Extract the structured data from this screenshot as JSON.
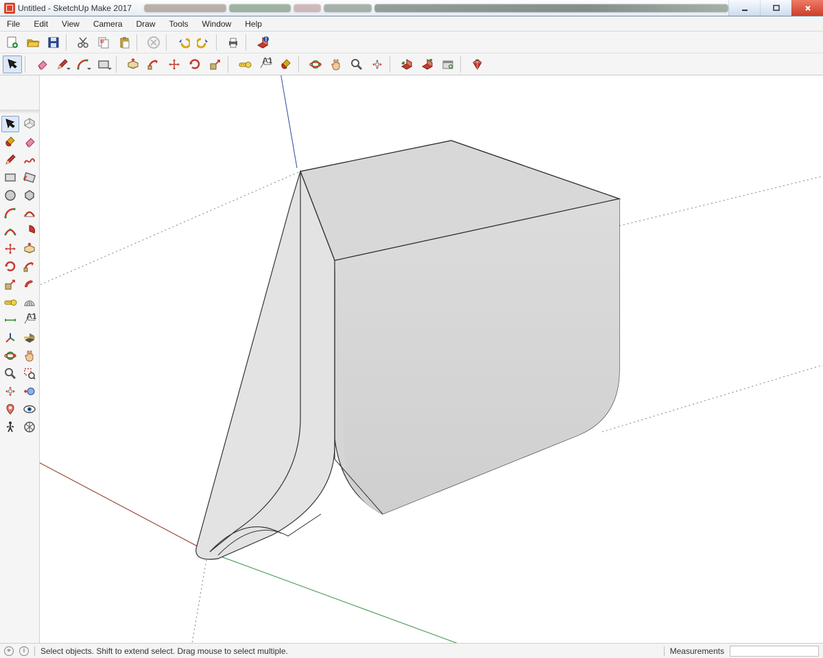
{
  "window": {
    "title": "Untitled - SketchUp Make 2017"
  },
  "menu": {
    "items": [
      "File",
      "Edit",
      "View",
      "Camera",
      "Draw",
      "Tools",
      "Window",
      "Help"
    ]
  },
  "status": {
    "hint": "Select objects. Shift to extend select. Drag mouse to select multiple.",
    "measurements_label": "Measurements",
    "measurements_value": ""
  },
  "toolbar_row1": [
    "new-file",
    "open-file",
    "save-file",
    "sep",
    "cut",
    "copy",
    "paste",
    "sep",
    "delete",
    "sep",
    "undo",
    "redo",
    "sep",
    "print",
    "sep",
    "model-info"
  ],
  "toolbar_row2": [
    "select",
    "sep",
    "eraser",
    "pencil",
    "arc",
    "rectangle",
    "sep",
    "push-pull",
    "follow-me",
    "move",
    "rotate",
    "scale",
    "sep",
    "tape-measure",
    "text-label",
    "paint-bucket",
    "sep",
    "orbit",
    "pan",
    "zoom",
    "zoom-extents",
    "sep",
    "get-models",
    "share-model",
    "extensions",
    "sep",
    "ruby"
  ],
  "left_toolbar": [
    "select",
    "make-component",
    "paint-bucket",
    "eraser",
    "pencil",
    "freehand",
    "rectangle",
    "rotated-rectangle",
    "circle",
    "polygon",
    "arc",
    "two-point-arc",
    "three-point-arc",
    "pie",
    "move",
    "push-pull",
    "rotate",
    "follow-me",
    "scale",
    "offset",
    "tape-measure",
    "protractor",
    "dimension",
    "text-label",
    "axes",
    "section-plane",
    "orbit",
    "pan",
    "zoom",
    "zoom-window",
    "zoom-extents",
    "previous-view",
    "position-camera",
    "look-around",
    "walk",
    "toggle-xray"
  ],
  "colors": {
    "red": "#c73a2d",
    "green": "#2f8a3a",
    "blue": "#2b4a9b",
    "yellow": "#d6a915",
    "grey": "#6a6a6a",
    "pink": "#e06a8a",
    "tan": "#c8b27a"
  }
}
